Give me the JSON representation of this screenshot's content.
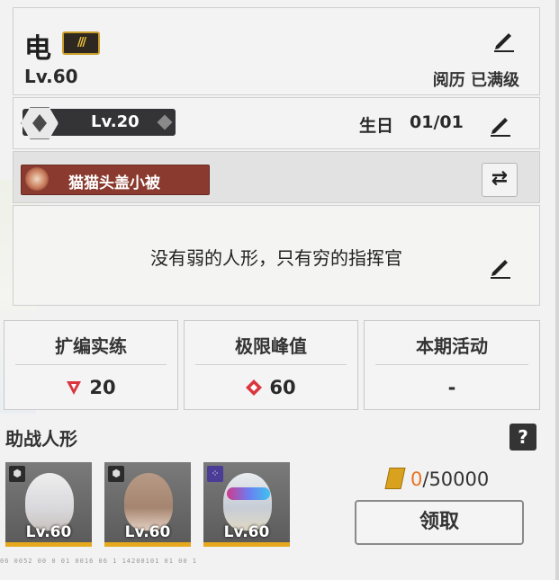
{
  "profile": {
    "name": "电",
    "name_badge_icon": "triple-slash-badge-icon",
    "level": "Lv.60",
    "experience_status": "阅历 已满级",
    "rank_level": "Lv.20",
    "birthday_label": "生日",
    "birthday_value": "01/01",
    "medal_title": "猫猫头盖小被",
    "signature": "没有弱的人形，只有穷的指挥官"
  },
  "stats": [
    {
      "title": "扩编实练",
      "value": "20",
      "icon": "red-triangle-icon"
    },
    {
      "title": "极限峰值",
      "value": "60",
      "icon": "red-diamond-icon"
    },
    {
      "title": "本期活动",
      "value": "-"
    }
  ],
  "support": {
    "title": "助战人形",
    "help_label": "?",
    "dolls": [
      {
        "level": "Lv.60",
        "type_icon": "hexagon-type-icon"
      },
      {
        "level": "Lv.60",
        "type_icon": "hexagon-type-icon"
      },
      {
        "level": "Lv.60",
        "type_icon": "purple-dots-type-icon"
      }
    ],
    "reward_current": "0",
    "reward_max": "/50000",
    "claim_label": "领取"
  },
  "colors": {
    "accent_red": "#d9363e",
    "reward_orange": "#e8731f",
    "card_bar": "#e6a81c",
    "medal_red": "#8a3a2e"
  },
  "footer_ticks": "06 0052 00 0 01   0016   06    1   14200101   01 00 1"
}
